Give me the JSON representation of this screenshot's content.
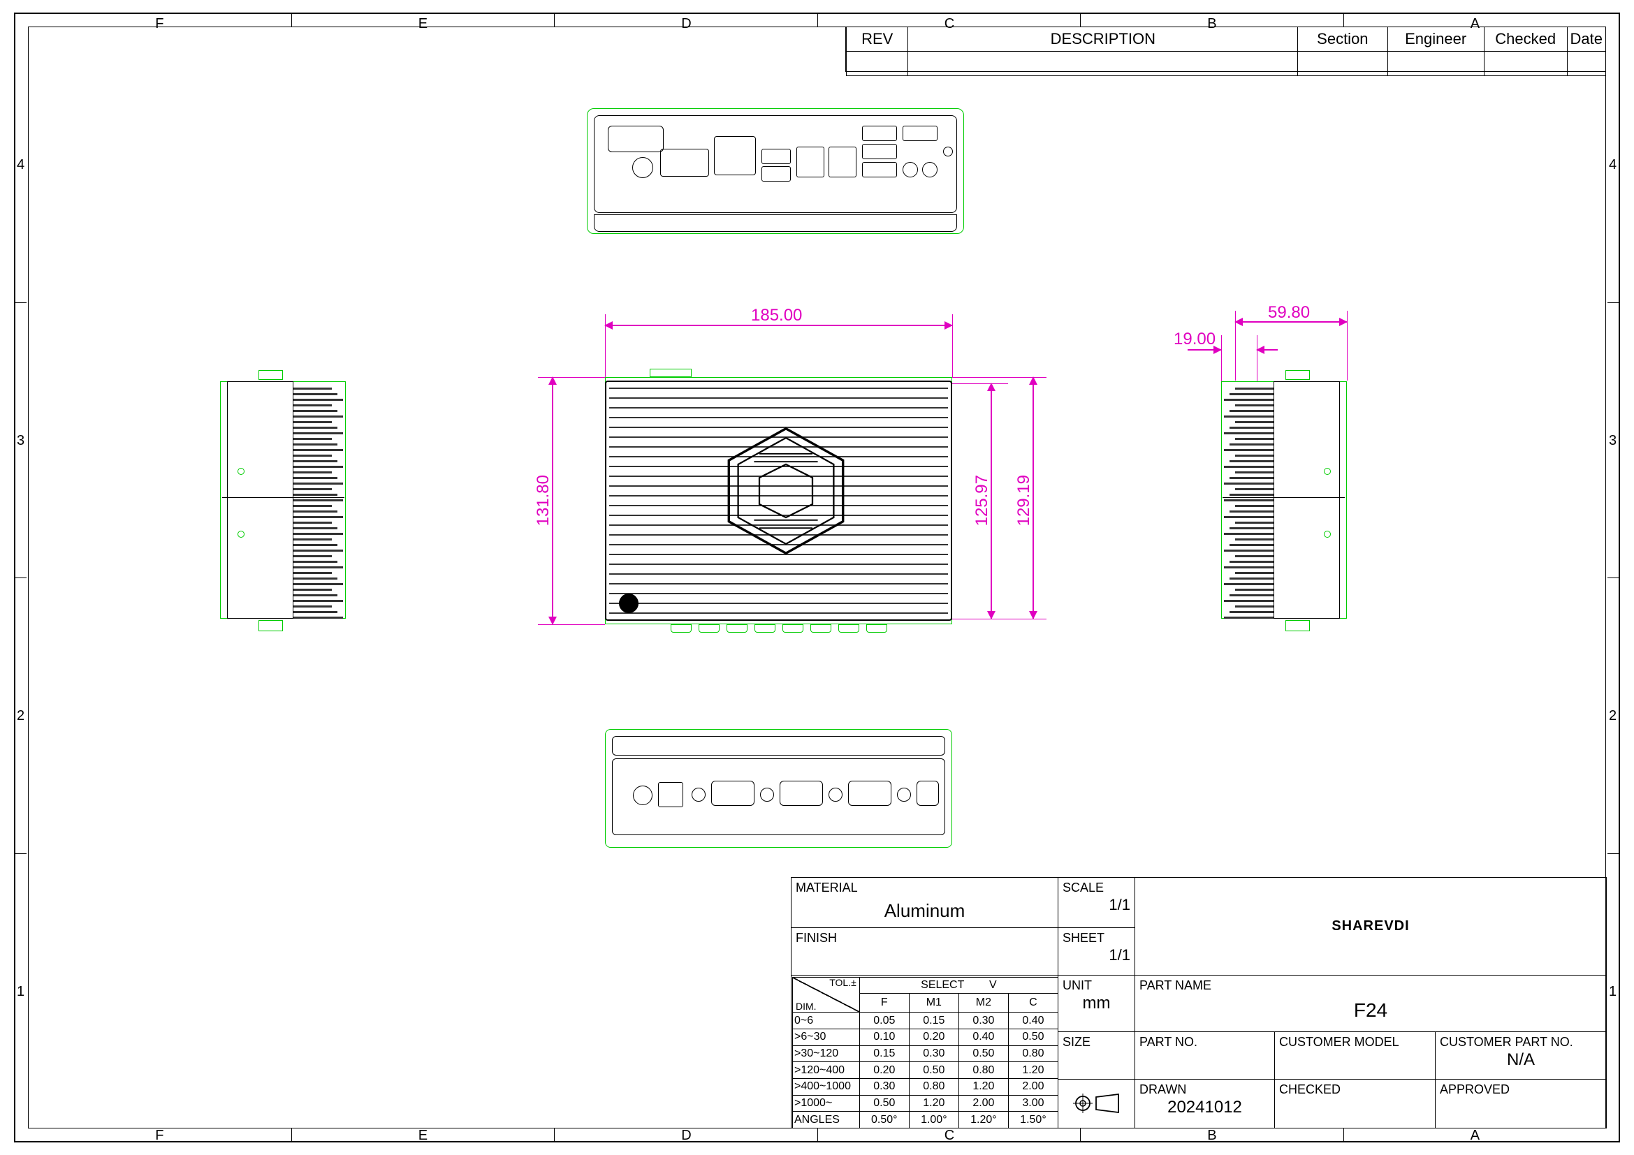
{
  "revision_block": {
    "headers": [
      "REV",
      "DESCRIPTION",
      "Section",
      "Engineer",
      "Checked",
      "Date"
    ]
  },
  "dimensions": {
    "top_width": "185.00",
    "left_height": "131.80",
    "mid_height1": "125.97",
    "mid_height2": "129.19",
    "right_offset": "19.00",
    "right_width": "59.80"
  },
  "title_block": {
    "material_label": "MATERIAL",
    "material_value": "Aluminum",
    "finish_label": "FINISH",
    "scale_label": "SCALE",
    "scale_value": "1/1",
    "sheet_label": "SHEET",
    "sheet_value": "1/1",
    "unit_label": "UNIT",
    "unit_value": "mm",
    "size_label": "SIZE",
    "company": "SHAREVDI",
    "part_name_label": "PART NAME",
    "part_name_value": "F24",
    "part_no_label": "PART NO.",
    "customer_model_label": "CUSTOMER MODEL",
    "customer_part_label": "CUSTOMER PART NO.",
    "customer_part_value": "N/A",
    "drawn_label": "DRAWN",
    "drawn_value": "20241012",
    "checked_label": "CHECKED",
    "approved_label": "APPROVED"
  },
  "tolerance_table": {
    "select_label": "SELECT",
    "dim_label": "DIM.",
    "tol_label": "TOL.±",
    "v_header": "V",
    "cols": [
      "F",
      "M1",
      "M2",
      "C"
    ],
    "rows": [
      {
        "range": "0~6",
        "vals": [
          "0.05",
          "0.15",
          "0.30",
          "0.40"
        ]
      },
      {
        "range": ">6~30",
        "vals": [
          "0.10",
          "0.20",
          "0.40",
          "0.50"
        ]
      },
      {
        "range": ">30~120",
        "vals": [
          "0.15",
          "0.30",
          "0.50",
          "0.80"
        ]
      },
      {
        "range": ">120~400",
        "vals": [
          "0.20",
          "0.50",
          "0.80",
          "1.20"
        ]
      },
      {
        "range": ">400~1000",
        "vals": [
          "0.30",
          "0.80",
          "1.20",
          "2.00"
        ]
      },
      {
        "range": ">1000~",
        "vals": [
          "0.50",
          "1.20",
          "2.00",
          "3.00"
        ]
      },
      {
        "range": "ANGLES",
        "vals": [
          "0.50°",
          "1.00°",
          "1.20°",
          "1.50°"
        ]
      }
    ]
  },
  "zones": {
    "cols": [
      "F",
      "E",
      "D",
      "C",
      "B",
      "A"
    ],
    "rows": [
      "4",
      "3",
      "2",
      "1"
    ]
  }
}
